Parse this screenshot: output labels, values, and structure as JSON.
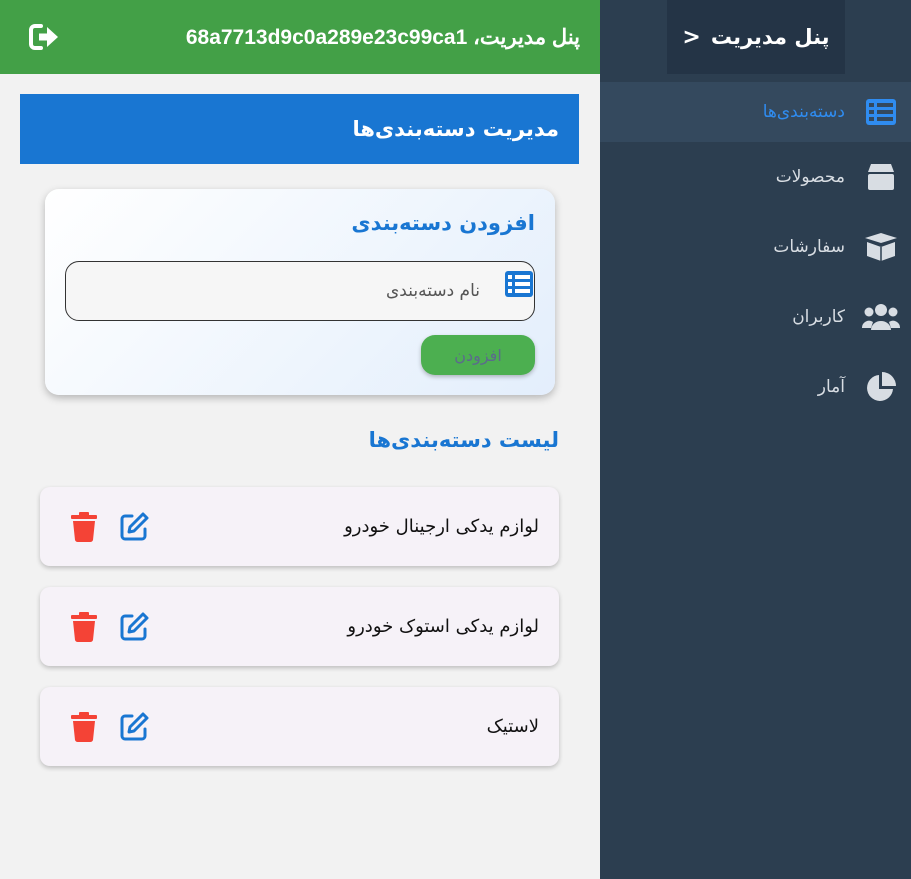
{
  "sidebar": {
    "title": "پنل مدیریت",
    "toggle_glyph": "<",
    "items": [
      {
        "label": "دسته‌بندی‌ها",
        "icon": "list-icon",
        "active": true
      },
      {
        "label": "محصولات",
        "icon": "box-icon",
        "active": false
      },
      {
        "label": "سفارشات",
        "icon": "open-box-icon",
        "active": false
      },
      {
        "label": "کاربران",
        "icon": "users-icon",
        "active": false
      },
      {
        "label": "آمار",
        "icon": "pie-chart-icon",
        "active": false
      }
    ]
  },
  "topbar": {
    "greeting": "پنل مدیریت، 68a7713d9c0a289e23c99ca1",
    "logout_icon": "logout-icon"
  },
  "main": {
    "section_title": "مدیریت دسته‌بندی‌ها",
    "add_form": {
      "title": "افزودن دسته‌بندی",
      "input_placeholder": "نام دسته‌بندی",
      "input_value": "",
      "submit_label": "افزودن"
    },
    "list_title": "لیست دسته‌بندی‌ها",
    "categories": [
      {
        "name": "لوازم یدکی ارجینال خودرو"
      },
      {
        "name": "لوازم یدکی استوک خودرو"
      },
      {
        "name": "لاستیک"
      }
    ]
  },
  "colors": {
    "topbar": "#43a047",
    "sidebar": "#2c3e50",
    "accent": "#1976d2",
    "delete": "#f44336",
    "button": "#4caf50"
  }
}
